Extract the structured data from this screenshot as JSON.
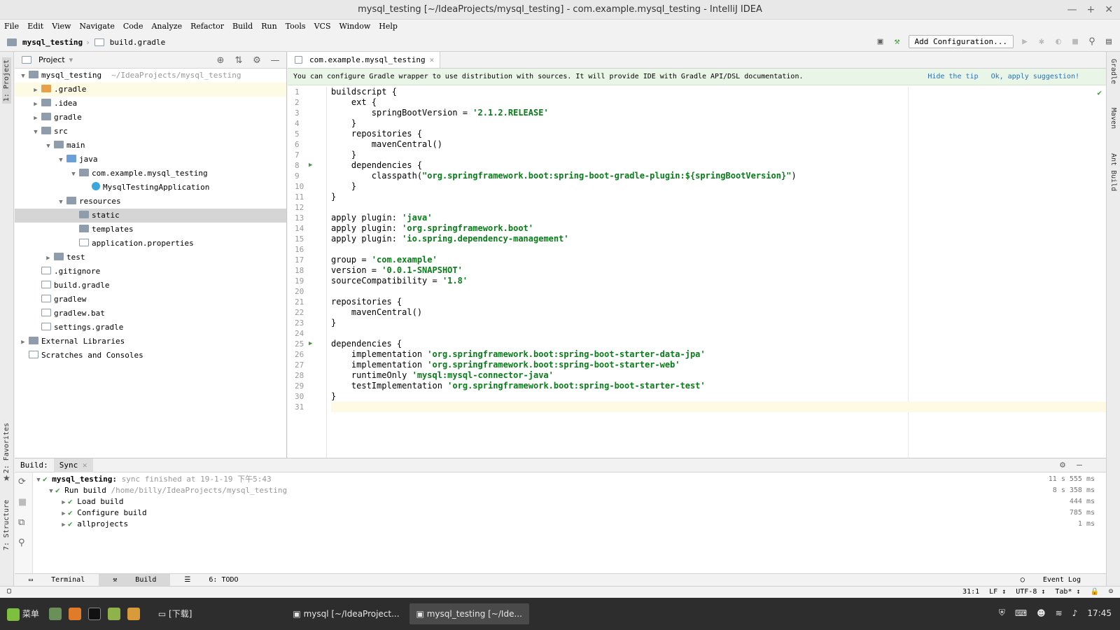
{
  "window": {
    "title": "mysql_testing [~/IdeaProjects/mysql_testing] - com.example.mysql_testing - IntelliJ IDEA",
    "controls": [
      "—",
      "+",
      "✕"
    ]
  },
  "menu": [
    "File",
    "Edit",
    "View",
    "Navigate",
    "Code",
    "Analyze",
    "Refactor",
    "Build",
    "Run",
    "Tools",
    "VCS",
    "Window",
    "Help"
  ],
  "navbar": {
    "project": "mysql_testing",
    "file": "build.gradle",
    "add_configuration": "Add Configuration..."
  },
  "side_left": {
    "project": "1: Project",
    "favorites": "2: Favorites",
    "structure": "7: Structure"
  },
  "side_right": {
    "gradle": "Gradle",
    "maven": "Maven",
    "ant": "Ant Build"
  },
  "project_panel": {
    "title": "Project",
    "tree": [
      {
        "label": "mysql_testing",
        "hint": "~/IdeaProjects/mysql_testing",
        "indent": 0,
        "arrow": "▼",
        "icon": "folder",
        "state": ""
      },
      {
        "label": ".gradle",
        "hint": "",
        "indent": 1,
        "arrow": "▶",
        "icon": "folder orange",
        "state": "hl"
      },
      {
        "label": ".idea",
        "hint": "",
        "indent": 1,
        "arrow": "▶",
        "icon": "folder",
        "state": ""
      },
      {
        "label": "gradle",
        "hint": "",
        "indent": 1,
        "arrow": "▶",
        "icon": "folder",
        "state": ""
      },
      {
        "label": "src",
        "hint": "",
        "indent": 1,
        "arrow": "▼",
        "icon": "folder",
        "state": ""
      },
      {
        "label": "main",
        "hint": "",
        "indent": 2,
        "arrow": "▼",
        "icon": "folder",
        "state": ""
      },
      {
        "label": "java",
        "hint": "",
        "indent": 3,
        "arrow": "▼",
        "icon": "folder blue",
        "state": ""
      },
      {
        "label": "com.example.mysql_testing",
        "hint": "",
        "indent": 4,
        "arrow": "▼",
        "icon": "folder",
        "state": ""
      },
      {
        "label": "MysqlTestingApplication",
        "hint": "",
        "indent": 5,
        "arrow": "",
        "icon": "cls",
        "state": ""
      },
      {
        "label": "resources",
        "hint": "",
        "indent": 3,
        "arrow": "▼",
        "icon": "folder",
        "state": ""
      },
      {
        "label": "static",
        "hint": "",
        "indent": 4,
        "arrow": "",
        "icon": "folder",
        "state": "sel"
      },
      {
        "label": "templates",
        "hint": "",
        "indent": 4,
        "arrow": "",
        "icon": "folder",
        "state": ""
      },
      {
        "label": "application.properties",
        "hint": "",
        "indent": 4,
        "arrow": "",
        "icon": "file",
        "state": ""
      },
      {
        "label": "test",
        "hint": "",
        "indent": 2,
        "arrow": "▶",
        "icon": "folder",
        "state": ""
      },
      {
        "label": ".gitignore",
        "hint": "",
        "indent": 1,
        "arrow": "",
        "icon": "file",
        "state": ""
      },
      {
        "label": "build.gradle",
        "hint": "",
        "indent": 1,
        "arrow": "",
        "icon": "file",
        "state": ""
      },
      {
        "label": "gradlew",
        "hint": "",
        "indent": 1,
        "arrow": "",
        "icon": "file",
        "state": ""
      },
      {
        "label": "gradlew.bat",
        "hint": "",
        "indent": 1,
        "arrow": "",
        "icon": "file",
        "state": ""
      },
      {
        "label": "settings.gradle",
        "hint": "",
        "indent": 1,
        "arrow": "",
        "icon": "file",
        "state": ""
      },
      {
        "label": "External Libraries",
        "hint": "",
        "indent": 0,
        "arrow": "▶",
        "icon": "folder",
        "state": ""
      },
      {
        "label": "Scratches and Consoles",
        "hint": "",
        "indent": 0,
        "arrow": "",
        "icon": "file",
        "state": ""
      }
    ]
  },
  "editor": {
    "tab": "com.example.mysql_testing",
    "tip": "You can configure Gradle wrapper to use distribution with sources. It will provide IDE with Gradle API/DSL documentation.",
    "tip_hide": "Hide the tip",
    "tip_apply": "Ok, apply suggestion!",
    "lines": [
      "buildscript {",
      "    ext {",
      "        springBootVersion = '2.1.2.RELEASE'",
      "    }",
      "    repositories {",
      "        mavenCentral()",
      "    }",
      "    dependencies {",
      "        classpath(\"org.springframework.boot:spring-boot-gradle-plugin:${springBootVersion}\")",
      "    }",
      "}",
      "",
      "apply plugin: 'java'",
      "apply plugin: 'org.springframework.boot'",
      "apply plugin: 'io.spring.dependency-management'",
      "",
      "group = 'com.example'",
      "version = '0.0.1-SNAPSHOT'",
      "sourceCompatibility = '1.8'",
      "",
      "repositories {",
      "    mavenCentral()",
      "}",
      "",
      "dependencies {",
      "    implementation 'org.springframework.boot:spring-boot-starter-data-jpa'",
      "    implementation 'org.springframework.boot:spring-boot-starter-web'",
      "    runtimeOnly 'mysql:mysql-connector-java'",
      "    testImplementation 'org.springframework.boot:spring-boot-starter-test'",
      "}",
      ""
    ]
  },
  "build_panel": {
    "label": "Build:",
    "tab": "Sync",
    "rows": [
      {
        "label": "mysql_testing:",
        "detail": "sync finished at 19-1-19 下午5:43",
        "time": "11 s 555 ms",
        "indent": 0,
        "bold": true
      },
      {
        "label": "Run build",
        "detail": "/home/billy/IdeaProjects/mysql_testing",
        "time": "8 s 358 ms",
        "indent": 1,
        "bold": false
      },
      {
        "label": "Load build",
        "detail": "",
        "time": "444 ms",
        "indent": 2,
        "bold": false
      },
      {
        "label": "Configure build",
        "detail": "",
        "time": "785 ms",
        "indent": 2,
        "bold": false
      },
      {
        "label": "allprojects",
        "detail": "",
        "time": "1 ms",
        "indent": 2,
        "bold": false
      }
    ]
  },
  "tool_windows": {
    "terminal": "Terminal",
    "build": "Build",
    "todo": "6: TODO",
    "event_log": "Event Log"
  },
  "status": {
    "position": "31:1",
    "line_sep": "LF ↕",
    "encoding": "UTF-8 ↕",
    "indent": "Tab* ↕"
  },
  "taskbar": {
    "menu": "菜单",
    "downloads": "[下载]",
    "win1": "mysql [~/IdeaProject...",
    "win2": "mysql_testing [~/Ide...",
    "clock": "17:45"
  }
}
